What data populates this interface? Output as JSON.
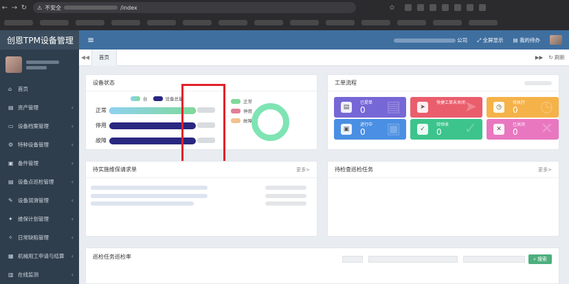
{
  "browser": {
    "security_warning": "不安全",
    "url_path": "/index"
  },
  "sidebar": {
    "app_title": "创恩TPM设备管理",
    "items": [
      {
        "label": "首页",
        "icon": "home-icon",
        "glyph": "⌂",
        "has_children": false
      },
      {
        "label": "资产管理",
        "icon": "asset-icon",
        "glyph": "▤",
        "has_children": true
      },
      {
        "label": "设备档案管理",
        "icon": "monitor-icon",
        "glyph": "▭",
        "has_children": true
      },
      {
        "label": "特种设备管理",
        "icon": "car-icon",
        "glyph": "⚙",
        "has_children": true
      },
      {
        "label": "备件管理",
        "icon": "part-icon",
        "glyph": "▣",
        "has_children": true
      },
      {
        "label": "设备点巡检管理",
        "icon": "inspect-icon",
        "glyph": "▤",
        "has_children": true
      },
      {
        "label": "设备润滑管理",
        "icon": "wrench-icon",
        "glyph": "✎",
        "has_children": true
      },
      {
        "label": "维保计划管理",
        "icon": "plan-icon",
        "glyph": "✦",
        "has_children": true
      },
      {
        "label": "日常缺陷管理",
        "icon": "defect-icon",
        "glyph": "✧",
        "has_children": true
      },
      {
        "label": "机械用工申请与结算",
        "icon": "labor-icon",
        "glyph": "▦",
        "has_children": true
      },
      {
        "label": "在线监测",
        "icon": "monitor-online-icon",
        "glyph": "▥",
        "has_children": true
      }
    ]
  },
  "topbar": {
    "company_suffix": "公司",
    "fullscreen_label": "全屏显示",
    "todo_label": "我的待办"
  },
  "tabs": {
    "home_label": "首页",
    "refresh_label": "刷新"
  },
  "equipment_status": {
    "title": "设备状态",
    "legend_unit": "台",
    "legend_total": "设备总量",
    "status_normal": "正常",
    "status_stopped": "停用",
    "status_fault": "故障",
    "fill_fraction": {
      "normal": 1.0,
      "stopped": 0.0,
      "fault": 0.0
    },
    "colors": {
      "normal": "#7fd99a",
      "stopped": "#e07f95",
      "fault": "#f2c28c",
      "total": "#2a2780"
    }
  },
  "workflow": {
    "title": "工单流程",
    "cards": [
      {
        "label": "已提单",
        "value": "0",
        "icon": "order-icon",
        "color": "#7667d6"
      },
      {
        "label": "快捷工单未关闭",
        "value": "",
        "icon": "send-icon",
        "color": "#ea5e6c"
      },
      {
        "label": "待执行",
        "value": "0",
        "icon": "clock-icon",
        "color": "#f5b249"
      },
      {
        "label": "进行中",
        "value": "0",
        "icon": "progress-icon",
        "color": "#4a8fe3"
      },
      {
        "label": "待验收",
        "value": "0",
        "icon": "check-icon",
        "color": "#3cc48c"
      },
      {
        "label": "已关闭",
        "value": "0",
        "icon": "close-icon",
        "color": "#e877c0"
      }
    ]
  },
  "maintenance_requests": {
    "title": "待实施维保请求单",
    "more_label": "更多>"
  },
  "inspection_tasks": {
    "title": "待检查巡检任务",
    "more_label": "更多>"
  },
  "inspection_rate": {
    "title": "巡检任务巡检率",
    "search_label": "搜索"
  }
}
